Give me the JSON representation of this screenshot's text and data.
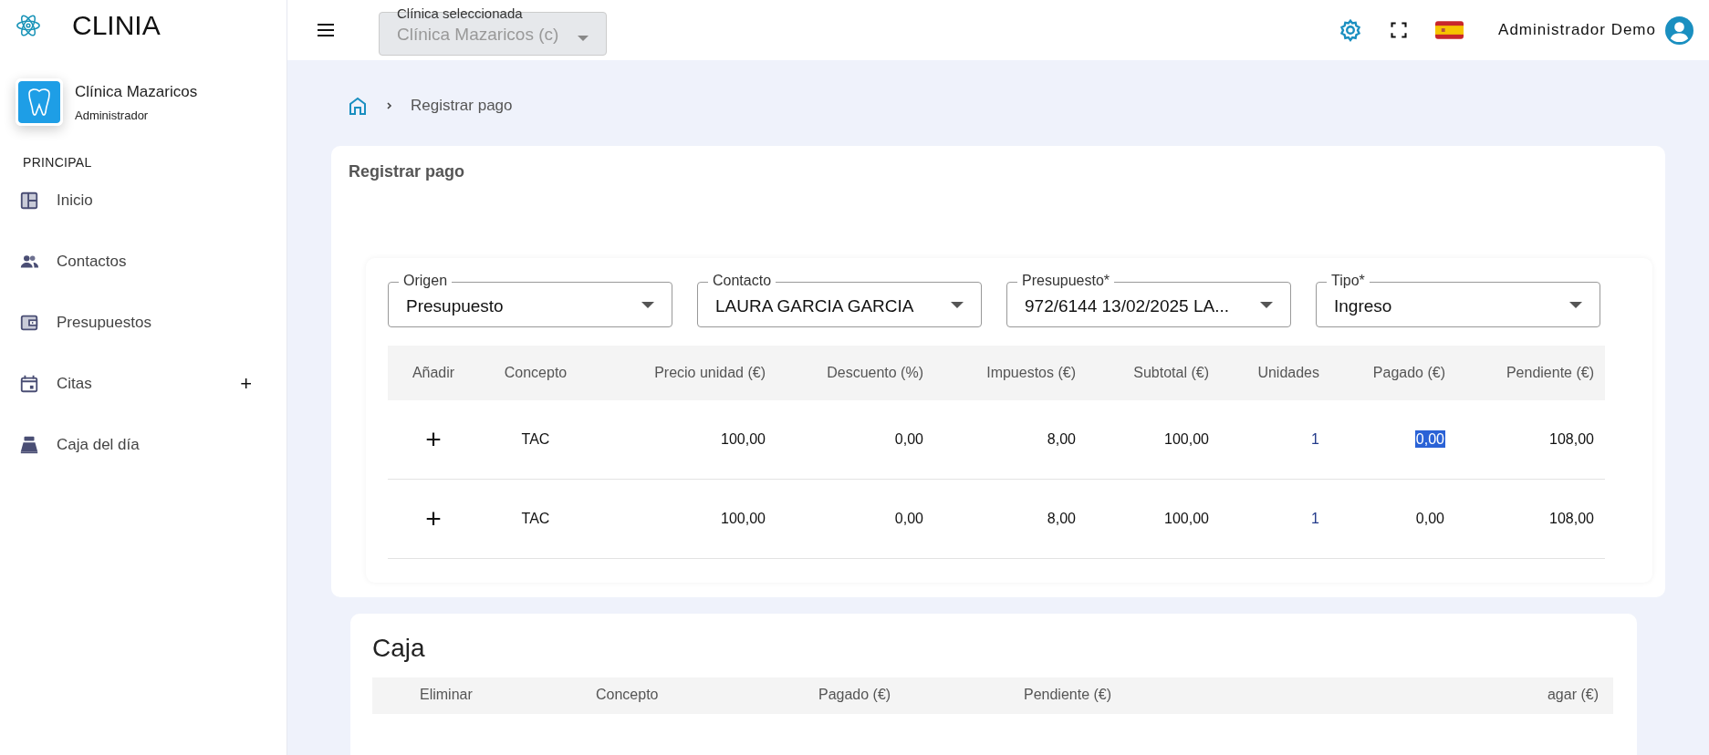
{
  "app": {
    "name": "CLINIA"
  },
  "topbar": {
    "clinic_select": {
      "label": "Clínica seleccionada",
      "value": "Clínica Mazaricos (c)",
      "disabled": true
    },
    "user": "Administrador Demo"
  },
  "profile": {
    "name": "Clínica Mazaricos",
    "role": "Administrador"
  },
  "sidebar": {
    "section": "PRINCIPAL",
    "items": [
      {
        "label": "Inicio"
      },
      {
        "label": "Contactos"
      },
      {
        "label": "Presupuestos"
      },
      {
        "label": "Citas",
        "action": "+"
      },
      {
        "label": "Caja del día"
      }
    ]
  },
  "breadcrumb": {
    "current": "Registrar pago"
  },
  "card": {
    "title": "Registrar pago"
  },
  "fields": [
    {
      "label": "Origen",
      "value": "Presupuesto"
    },
    {
      "label": "Contacto",
      "value": "LAURA GARCIA GARCIA"
    },
    {
      "label": "Presupuesto*",
      "value": "972/6144 13/02/2025 LA..."
    },
    {
      "label": "Tipo*",
      "value": "Ingreso"
    }
  ],
  "table": {
    "columns": [
      "Añadir",
      "Concepto",
      "Precio unidad (€)",
      "Descuento (%)",
      "Impuestos (€)",
      "Subtotal (€)",
      "Unidades",
      "Pagado (€)",
      "Pendiente (€)"
    ],
    "rows": [
      {
        "cells": [
          "+",
          "TAC",
          "100,00",
          "0,00",
          "8,00",
          "100,00",
          "1",
          "0,00",
          "108,00"
        ],
        "pagado_selected": true
      },
      {
        "cells": [
          "+",
          "TAC",
          "100,00",
          "0,00",
          "8,00",
          "100,00",
          "1",
          "0,00",
          "108,00"
        ],
        "pagado_selected": false
      }
    ]
  },
  "caja": {
    "title": "Caja",
    "columns": [
      "Eliminar",
      "Concepto",
      "Pagado (€)",
      "Pendiente (€)",
      "agar (€)"
    ]
  }
}
